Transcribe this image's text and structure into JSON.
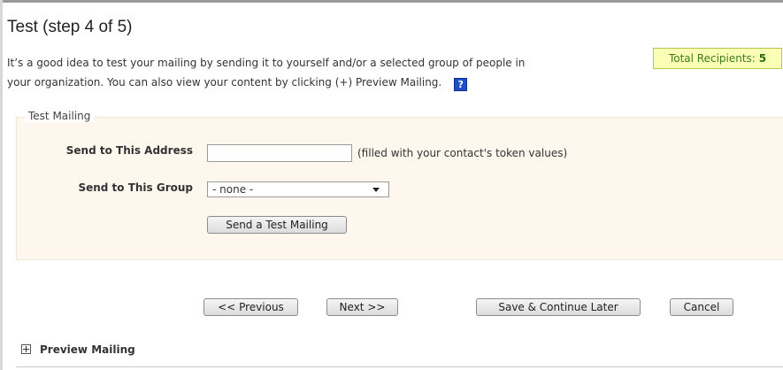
{
  "page": {
    "title": "Test (step 4 of 5)",
    "intro_line1": "It’s a good idea to test your mailing by sending it to yourself and/or a selected group of people in",
    "intro_line2": "your organization. You can also view your content by clicking (+) Preview Mailing.",
    "help_icon": "?"
  },
  "recipients": {
    "label": "Total Recipients:",
    "count": "5"
  },
  "test_mailing": {
    "legend": "Test Mailing",
    "address_label": "Send to This Address",
    "address_value": "",
    "address_hint": "(filled with your contact's token values)",
    "group_label": "Send to This Group",
    "group_selected": "- none -",
    "send_button": "Send a Test Mailing"
  },
  "nav": {
    "previous": "<< Previous",
    "next": "Next >>",
    "save": "Save & Continue Later",
    "cancel": "Cancel"
  },
  "preview": {
    "label": "Preview Mailing",
    "icon": "plus-box-icon"
  },
  "colors": {
    "recipients_bg": "#fbffb6",
    "recipients_text": "#3d7a1a",
    "fieldset_bg": "#fdf7ee",
    "help_icon_bg": "#1f4fc7"
  }
}
